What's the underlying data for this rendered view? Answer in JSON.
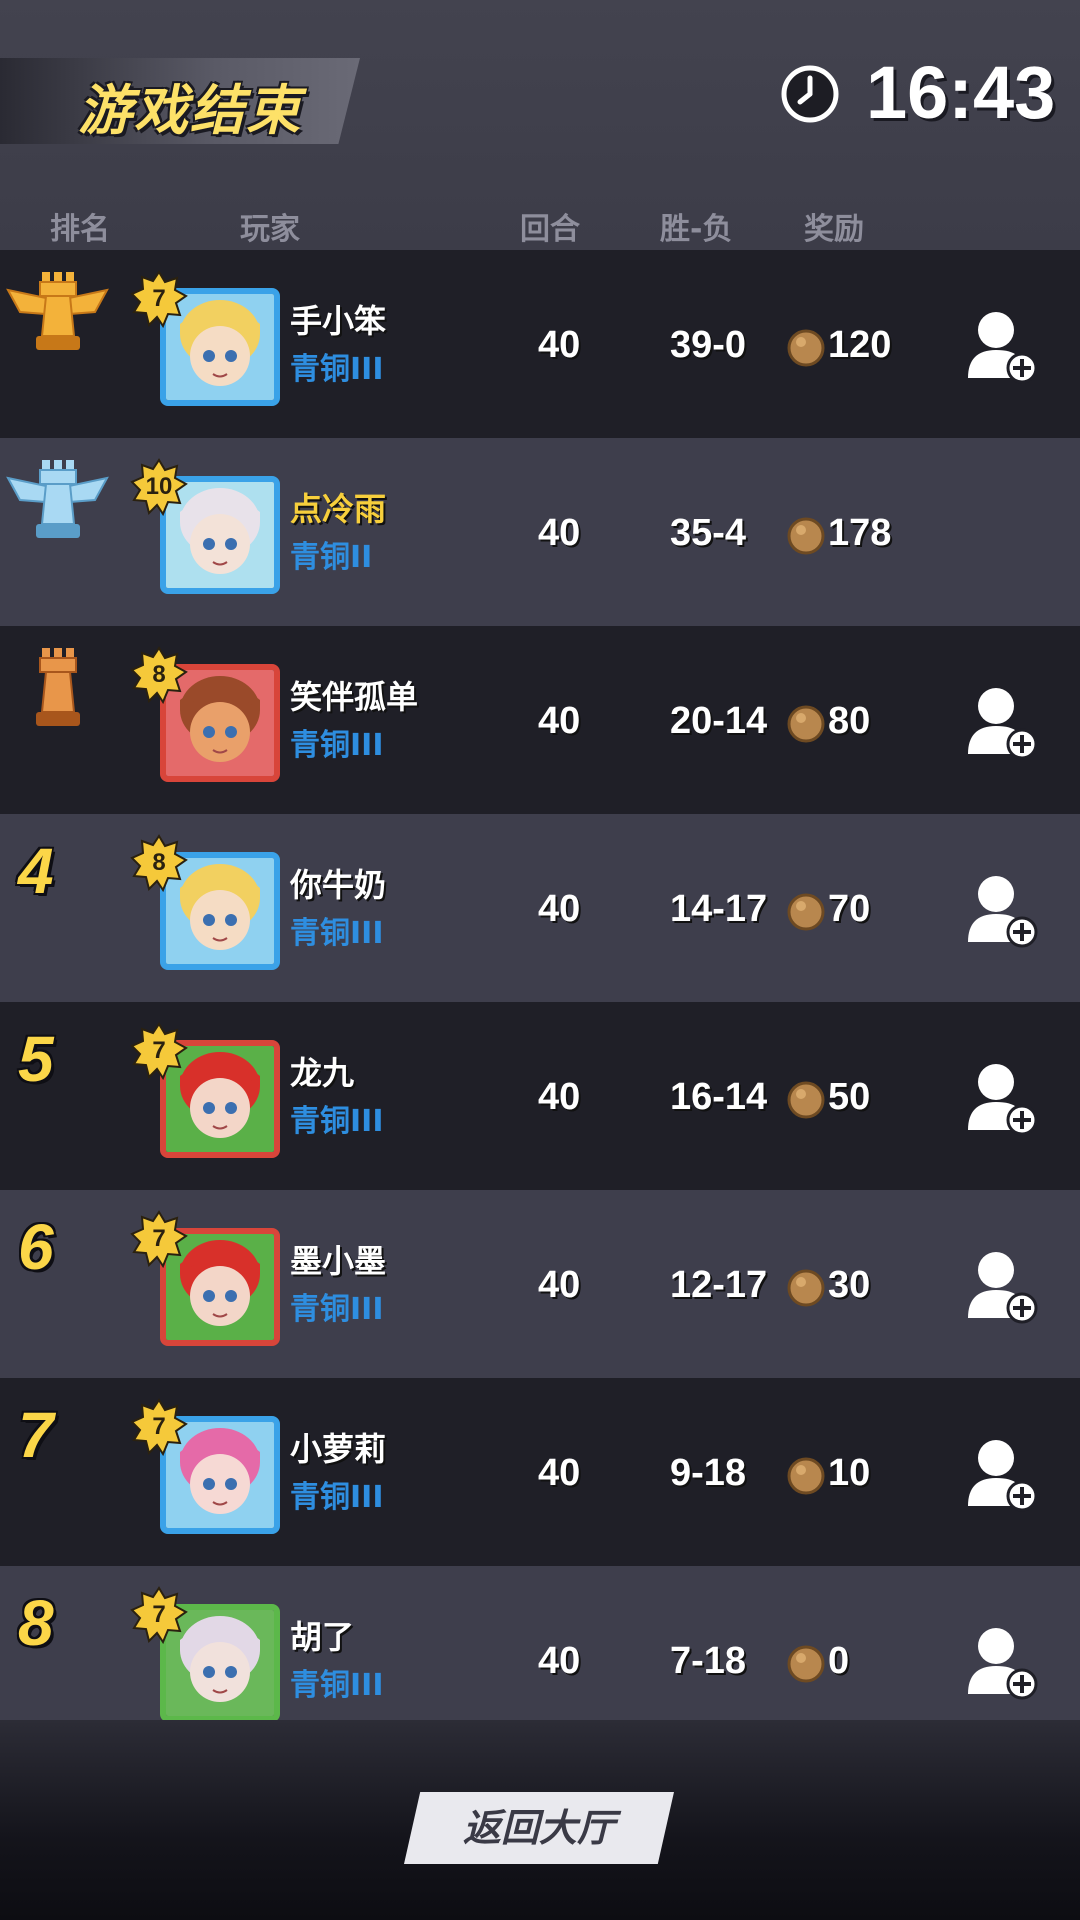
{
  "header": {
    "title": "游戏结束",
    "clock_icon": "clock-icon",
    "time": "16:43"
  },
  "columns": {
    "rank": "排名",
    "player": "玩家",
    "rounds": "回合",
    "win_loss": "胜-负",
    "reward": "奖励"
  },
  "rows": [
    {
      "rank": "1",
      "rank_icon": "gold-trophy-icon",
      "level": "7",
      "name": "手小笨",
      "tier": "青铜III",
      "rounds": "40",
      "record": "39-0",
      "reward": "120",
      "add_friend": true
    },
    {
      "rank": "2",
      "rank_icon": "silver-trophy-icon",
      "level": "10",
      "name": "点冷雨",
      "tier": "青铜II",
      "rounds": "40",
      "record": "35-4",
      "reward": "178",
      "add_friend": false
    },
    {
      "rank": "3",
      "rank_icon": "bronze-trophy-icon",
      "level": "8",
      "name": "笑伴孤单",
      "tier": "青铜III",
      "rounds": "40",
      "record": "20-14",
      "reward": "80",
      "add_friend": true
    },
    {
      "rank": "4",
      "level": "8",
      "name": "你牛奶",
      "tier": "青铜III",
      "rounds": "40",
      "record": "14-17",
      "reward": "70",
      "add_friend": true
    },
    {
      "rank": "5",
      "level": "7",
      "name": "龙九",
      "tier": "青铜III",
      "rounds": "40",
      "record": "16-14",
      "reward": "50",
      "add_friend": true
    },
    {
      "rank": "6",
      "level": "7",
      "name": "墨小墨",
      "tier": "青铜III",
      "rounds": "40",
      "record": "12-17",
      "reward": "30",
      "add_friend": true
    },
    {
      "rank": "7",
      "level": "7",
      "name": "小萝莉",
      "tier": "青铜III",
      "rounds": "40",
      "record": "9-18",
      "reward": "10",
      "add_friend": true
    },
    {
      "rank": "8",
      "level": "7",
      "name": "胡了",
      "tier": "青铜III",
      "rounds": "40",
      "record": "7-18",
      "reward": "0",
      "add_friend": true
    }
  ],
  "footer": {
    "return_label": "返回大厅"
  },
  "colors": {
    "title_yellow": "#fde168",
    "tier_blue": "#2e8ee0",
    "highlight_name": "#f7cf3c",
    "rank_yellow": "#fbd648"
  }
}
